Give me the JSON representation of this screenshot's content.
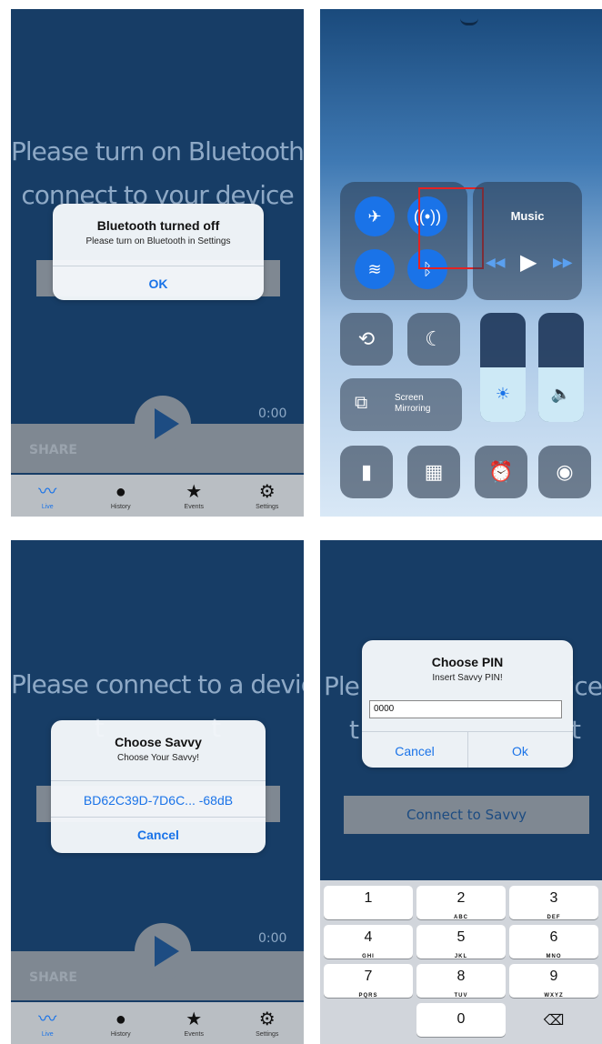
{
  "screen1": {
    "headline_line1": "Please turn on Bluetooth to",
    "headline_line2": "connect to your device",
    "alert": {
      "title": "Bluetooth turned off",
      "message": "Please turn on Bluetooth in Settings",
      "ok": "OK"
    },
    "timer": "0:00",
    "share": "SHARE",
    "tabs": [
      {
        "label": "Live",
        "icon": "pulse-icon"
      },
      {
        "label": "History",
        "icon": "clock-icon"
      },
      {
        "label": "Events",
        "icon": "star-icon"
      },
      {
        "label": "Settings",
        "icon": "gear-icon"
      }
    ]
  },
  "screen2": {
    "music_label": "Music",
    "screen_mirroring_line1": "Screen",
    "screen_mirroring_line2": "Mirroring",
    "brightness_level": 0.5,
    "volume_level": 0.5
  },
  "screen3": {
    "headline_line1": "Please connect to a device",
    "headline_line2": "t               t",
    "alert": {
      "title": "Choose Savvy",
      "message": "Choose Your Savvy!",
      "device": "BD62C39D-7D6C... -68dB",
      "cancel": "Cancel"
    },
    "timer": "0:00",
    "share": "SHARE"
  },
  "screen4": {
    "headline_left": "Ple",
    "headline_right": "ice",
    "headline2_left": "t",
    "headline2_right": "t",
    "alert": {
      "title": "Choose PIN",
      "message": "Insert Savvy PIN!",
      "input_value": "0000",
      "cancel": "Cancel",
      "ok": "Ok"
    },
    "connect_button": "Connect to Savvy",
    "keys": [
      {
        "num": "1",
        "letters": ""
      },
      {
        "num": "2",
        "letters": "ABC"
      },
      {
        "num": "3",
        "letters": "DEF"
      },
      {
        "num": "4",
        "letters": "GHI"
      },
      {
        "num": "5",
        "letters": "JKL"
      },
      {
        "num": "6",
        "letters": "MNO"
      },
      {
        "num": "7",
        "letters": "PQRS"
      },
      {
        "num": "8",
        "letters": "TUV"
      },
      {
        "num": "9",
        "letters": "WXYZ"
      },
      {
        "num": "0",
        "letters": ""
      }
    ]
  }
}
